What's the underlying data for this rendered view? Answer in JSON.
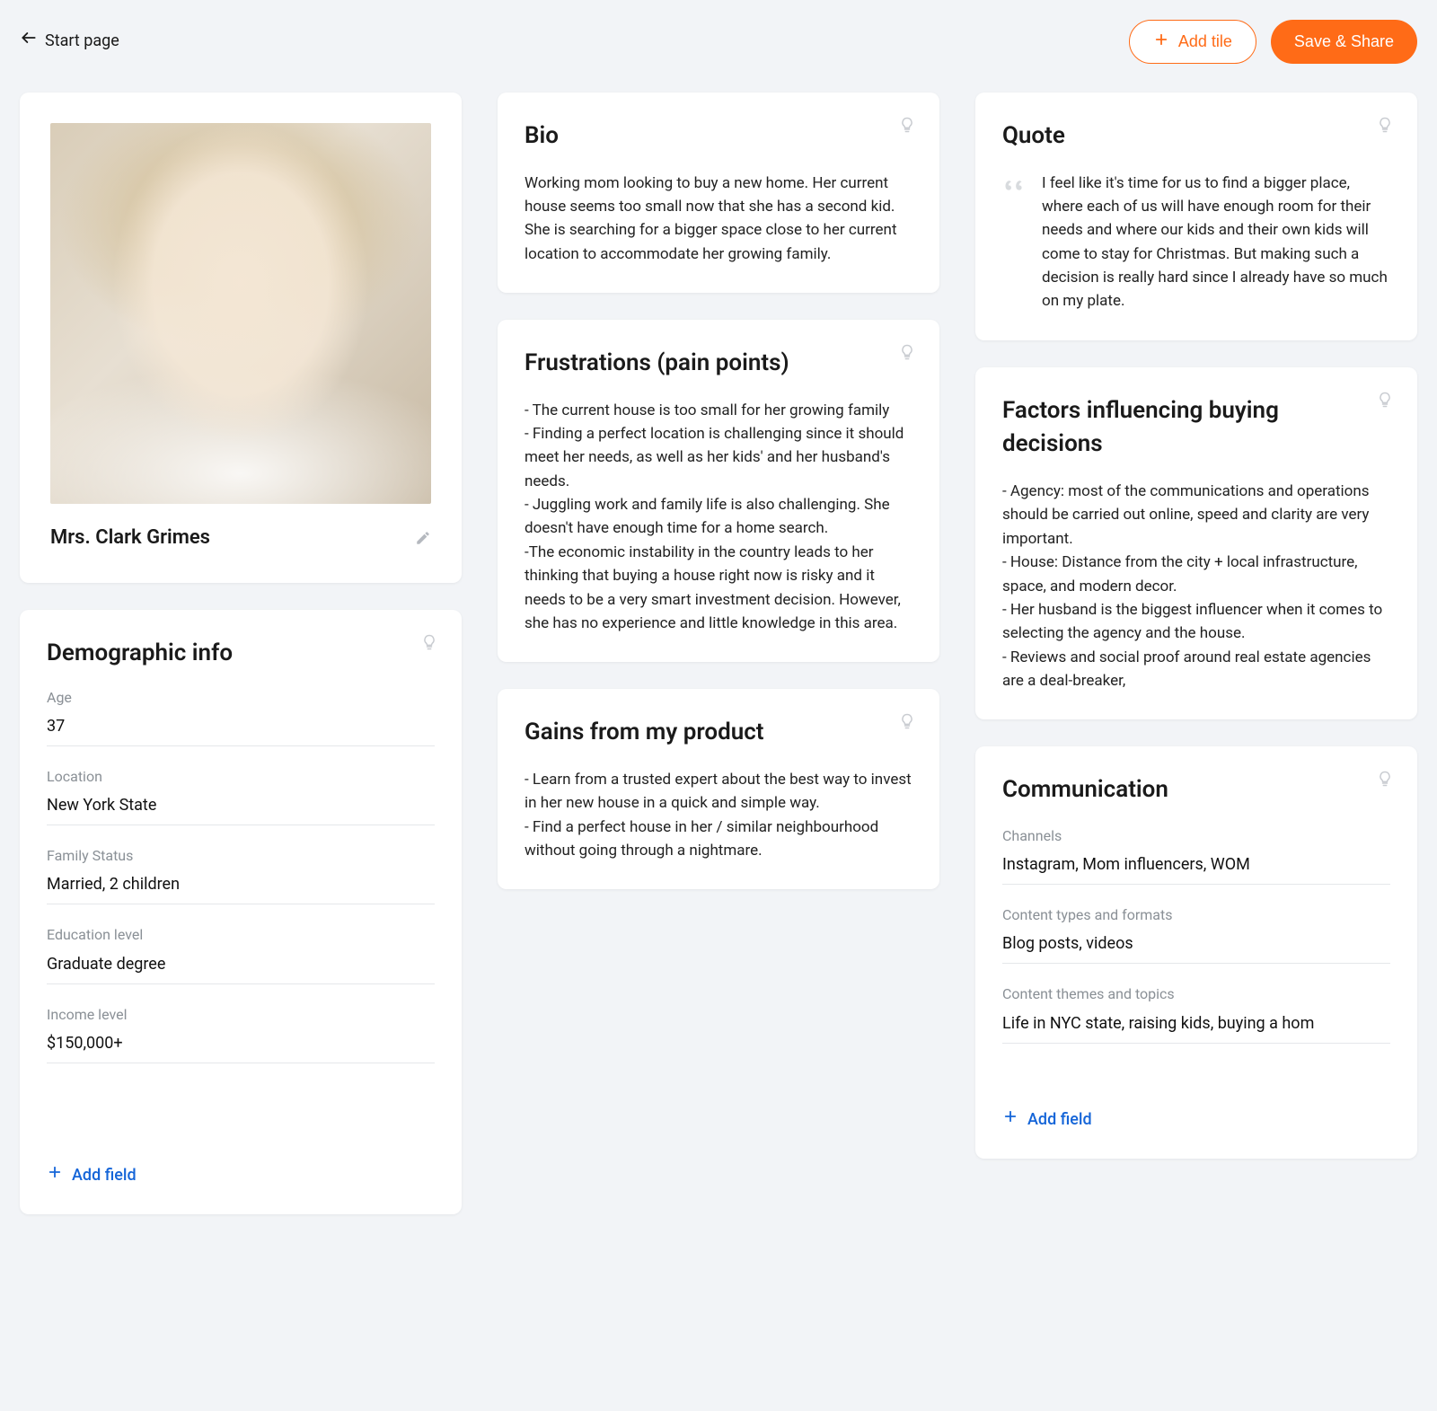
{
  "header": {
    "back_label": "Start page",
    "add_tile_label": "Add tile",
    "save_label": "Save & Share"
  },
  "profile": {
    "name": "Mrs. Clark Grimes"
  },
  "demographic": {
    "title": "Demographic info",
    "fields": {
      "age_label": "Age",
      "age_value": "37",
      "location_label": "Location",
      "location_value": "New York State",
      "family_label": "Family Status",
      "family_value": "Married, 2 children",
      "education_label": "Education level",
      "education_value": "Graduate degree",
      "income_label": "Income level",
      "income_value": "$150,000+"
    },
    "add_field_label": "Add field"
  },
  "bio": {
    "title": "Bio",
    "text": "Working mom looking to buy a new home. Her current house seems too small now that she has a second kid. She is searching for a bigger space close to her current location to accommodate her growing family."
  },
  "frustrations": {
    "title": "Frustrations (pain points)",
    "text": "- The current house is too small for her growing family\n- Finding a perfect location is challenging since it should meet her needs, as well as her kids' and her husband's needs.\n- Juggling work and family life is also challenging. She doesn't have enough time for a home search.\n-The economic instability in the country leads to her thinking that buying a house right now is risky and it needs to be a very smart investment decision. However, she has no experience and little knowledge in this area."
  },
  "gains": {
    "title": "Gains from my product",
    "text": "- Learn from a trusted expert about the best way to invest in her new house in a quick and simple way.\n- Find a perfect house in her / similar neighbourhood without going through a nightmare."
  },
  "quote": {
    "title": "Quote",
    "text": "I feel like it's time for us to find a bigger place, where each of us will have enough room for their needs and where our kids and their own kids will come to stay for Christmas. But making such a decision is really hard since I already have so much on my plate."
  },
  "factors": {
    "title": "Factors influencing buying decisions",
    "text": "- Agency: most of the communications and operations should be carried out online, speed and clarity are very important.\n- House: Distance from the city + local infrastructure, space, and modern decor.\n- Her husband is the biggest influencer when it comes to selecting the agency and the house.\n- Reviews and social proof around real estate agencies are a deal-breaker,"
  },
  "communication": {
    "title": "Communication",
    "fields": {
      "channels_label": "Channels",
      "channels_value": "Instagram, Mom influencers, WOM",
      "content_types_label": "Content types and formats",
      "content_types_value": "Blog posts, videos",
      "content_themes_label": "Content themes and topics",
      "content_themes_value": "Life in NYC state, raising kids, buying a hom"
    },
    "add_field_label": "Add field"
  }
}
